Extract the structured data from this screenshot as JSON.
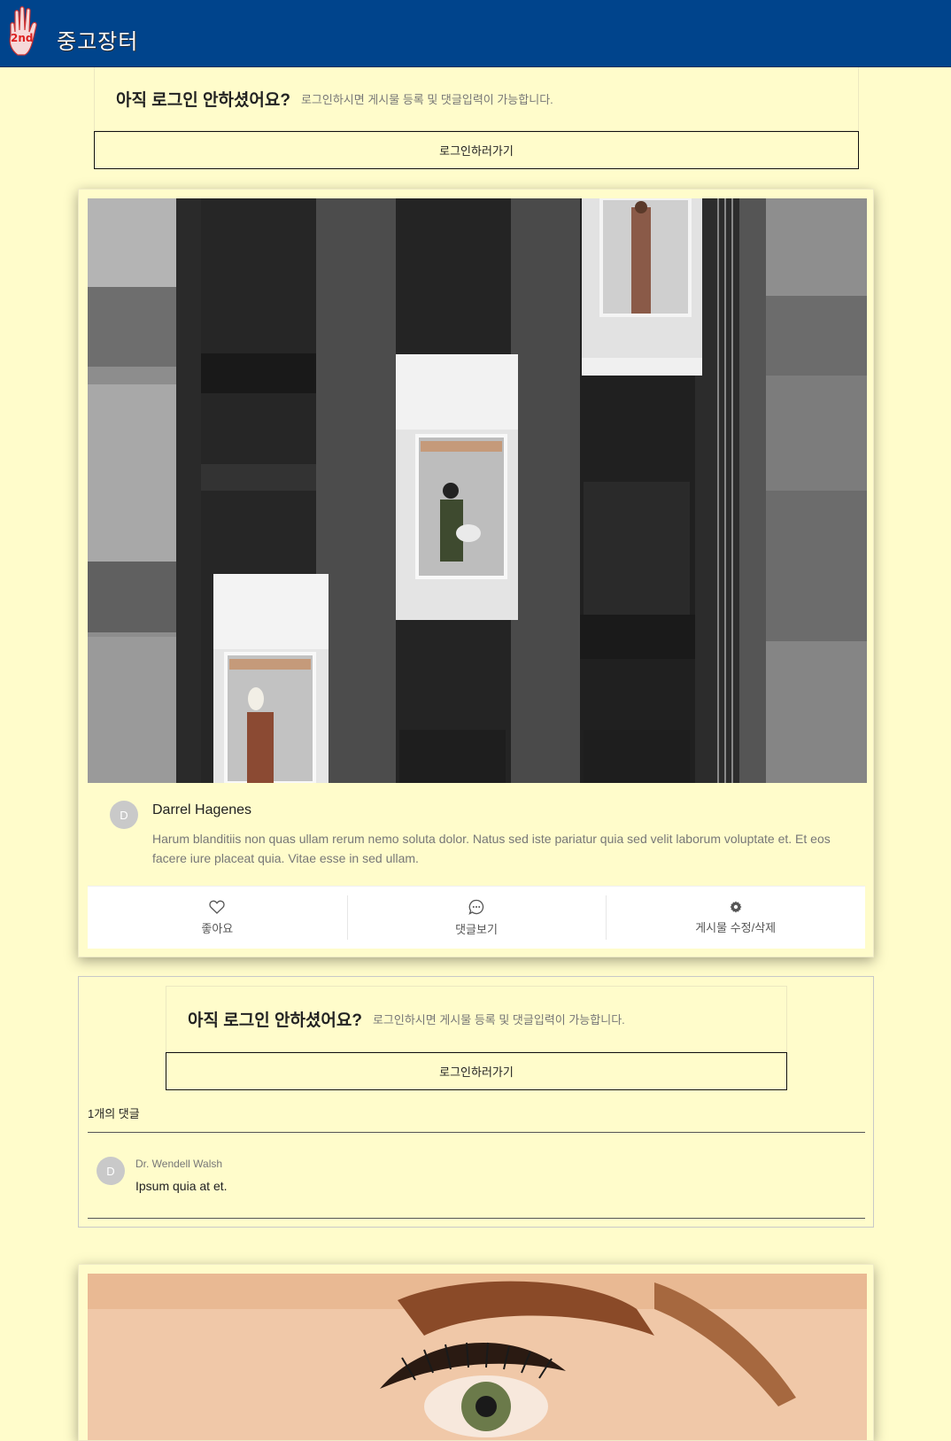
{
  "header": {
    "brand": "중고장터",
    "logo_text": "2nd",
    "logo_icon": "hand-logo-icon"
  },
  "login_prompt": {
    "title": "아직 로그인 안하셨어요?",
    "subtitle": "로그인하시면 게시물 등록 및 댓글입력이 가능합니다.",
    "button_label": "로그인하러가기"
  },
  "post": {
    "author_initial": "D",
    "author": "Darrel Hagenes",
    "body": "Harum blanditiis non quas ullam rerum nemo soluta dolor. Natus sed iste pariatur quia sed velit laborum voluptate et. Et eos facere iure placeat quia. Vitae esse in sed ullam.",
    "actions": {
      "like": "좋아요",
      "comments": "댓글보기",
      "edit": "게시물 수정/삭제"
    }
  },
  "comments": {
    "count_label": "1개의 댓글",
    "items": [
      {
        "initial": "D",
        "author": "Dr. Wendell Walsh",
        "text": "Ipsum quia at et."
      }
    ]
  },
  "colors": {
    "header_bg": "#00448c",
    "page_bg": "#fffccb"
  }
}
